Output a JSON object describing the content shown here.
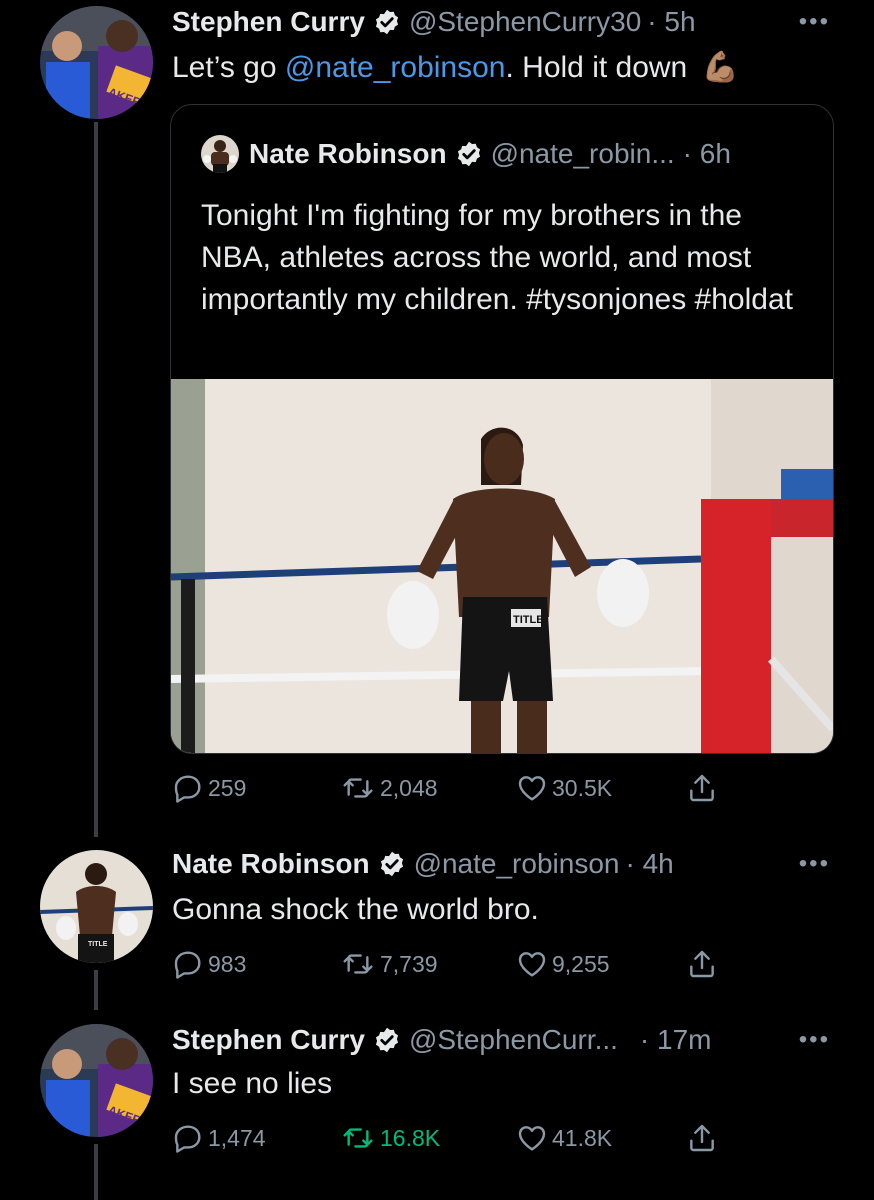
{
  "tweets": [
    {
      "author": "Stephen Curry",
      "handle": "@StephenCurry30",
      "time": "· 5h",
      "text_prefix": "Let’s go ",
      "mention": "@nate_robinson",
      "text_suffix": ". Hold it down",
      "emoji": "💪🏽",
      "quote": {
        "author": "Nate Robinson",
        "handle": "@nate_robin...",
        "time": "· 6h",
        "text": "Tonight I'm fighting for my brothers in the NBA, athletes across the world, and most importantly my children. #tysonjones #holdat",
        "logo_text": "TITLE"
      },
      "replies": "259",
      "retweets": "2,048",
      "likes": "30.5K"
    },
    {
      "author": "Nate Robinson",
      "handle": "@nate_robinson",
      "time": "· 4h",
      "text": "Gonna shock the world bro.",
      "replies": "983",
      "retweets": "7,739",
      "likes": "9,255",
      "logo_text": "TITLE"
    },
    {
      "author": "Stephen Curry",
      "handle": "@StephenCurr...",
      "time": "· 17m",
      "text": "I see no lies",
      "replies": "1,474",
      "retweets": "16.8K",
      "likes": "41.8K"
    }
  ],
  "more_label": "•••",
  "avatar_jersey_text": "AKERS",
  "colors": {
    "link": "#4a99e9",
    "muted": "#8b98a5",
    "retweeted": "#00ba7c",
    "verified": "#e7e9ea"
  },
  "icons": [
    "reply-icon",
    "retweet-icon",
    "like-icon",
    "share-icon",
    "verified-badge-icon",
    "more-options-icon"
  ]
}
